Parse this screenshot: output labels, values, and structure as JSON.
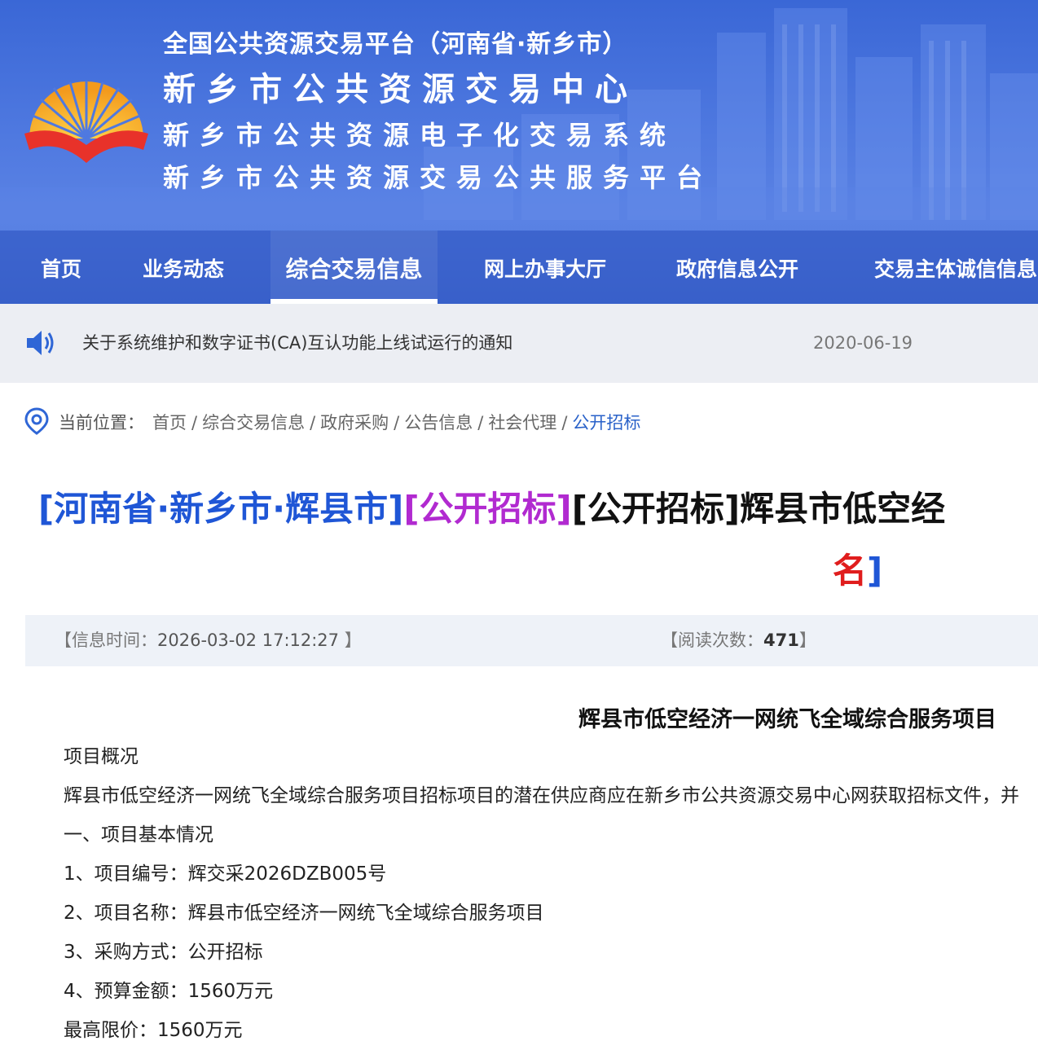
{
  "header": {
    "platform_line": "全国公共资源交易平台（河南省·新乡市）",
    "center_name": "新乡市公共资源交易中心",
    "system_name": "新乡市公共资源电子化交易系统",
    "service_platform": "新乡市公共资源交易公共服务平台",
    "logo_icon": "sunrise-book-logo"
  },
  "nav": {
    "items": [
      {
        "label": "首页"
      },
      {
        "label": "业务动态"
      },
      {
        "label": "综合交易信息",
        "active": true
      },
      {
        "label": "网上办事大厅"
      },
      {
        "label": "政府信息公开"
      },
      {
        "label": "交易主体诚信信息"
      }
    ]
  },
  "notice": {
    "icon": "speaker-icon",
    "text": "关于系统维护和数字证书(CA)互认功能上线试运行的通知",
    "date": "2020-06-19"
  },
  "breadcrumb": {
    "icon": "location-pin-icon",
    "label": "当前位置：",
    "items": [
      "首页",
      "综合交易信息",
      "政府采购",
      "公告信息",
      "社会代理",
      "公开招标"
    ],
    "separator": "/"
  },
  "article": {
    "title_location": "[河南省·新乡市·辉县市]",
    "title_category": "[公开招标]",
    "title_main": "[公开招标]辉县市低空经",
    "title_line2_red": "名",
    "title_line2_bracket": "]",
    "info": {
      "time_label": "【信息时间：",
      "time_value": "2026-03-02 17:12:27",
      "time_close": " 】",
      "reads_label": "【阅读次数：",
      "reads_value": "471",
      "reads_close": "】"
    },
    "doc_heading": "辉县市低空经济一网统飞全域综合服务项目",
    "paragraphs": [
      "项目概况",
      "辉县市低空经济一网统飞全域综合服务项目招标项目的潜在供应商应在新乡市公共资源交易中心网获取招标文件，并",
      "一、项目基本情况",
      "1、项目编号：辉交采2026DZB005号",
      "2、项目名称：辉县市低空经济一网统飞全域综合服务项目",
      "3、采购方式：公开招标",
      "4、预算金额：1560万元",
      "最高限价：1560万元"
    ]
  },
  "colors": {
    "header_blue": "#3f6cd9",
    "nav_active_underline": "#ffffff",
    "title_location_blue": "#1f56d6",
    "title_category_purple": "#b12ad0",
    "title_red": "#e01d1d",
    "breadcrumb_current": "#2a62c9"
  }
}
